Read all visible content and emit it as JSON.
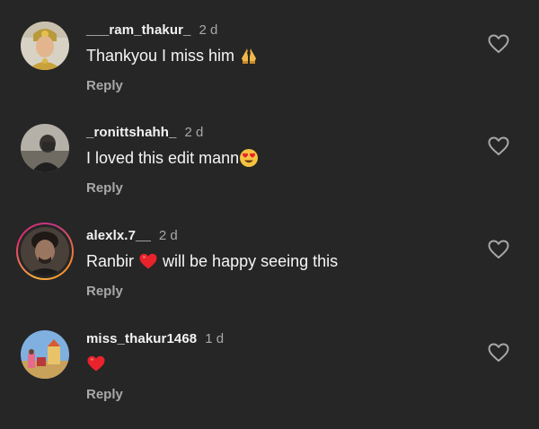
{
  "comments": [
    {
      "username": "___ram_thakur_",
      "time": "2 d",
      "text_before": "Thankyou I miss him ",
      "text_after": "",
      "emoji": "folded-hands-icon",
      "reply_label": "Reply"
    },
    {
      "username": "_ronittshahh_",
      "time": "2 d",
      "text_before": "I loved this edit mann",
      "text_after": "",
      "emoji": "heart-eyes-icon",
      "reply_label": "Reply"
    },
    {
      "username": "alexlx.7__",
      "time": "2 d",
      "text_before": "Ranbir ",
      "text_after": " will be happy seeing this",
      "emoji": "red-heart-icon",
      "reply_label": "Reply"
    },
    {
      "username": "miss_thakur1468",
      "time": "1 d",
      "text_before": "",
      "text_after": "",
      "emoji": "red-heart-icon",
      "reply_label": "Reply"
    }
  ],
  "colors": {
    "background": "#262626",
    "secondary_text": "#a8a8a8",
    "primary_text": "#f5f5f5",
    "heart_emoji": "#e8232b"
  }
}
